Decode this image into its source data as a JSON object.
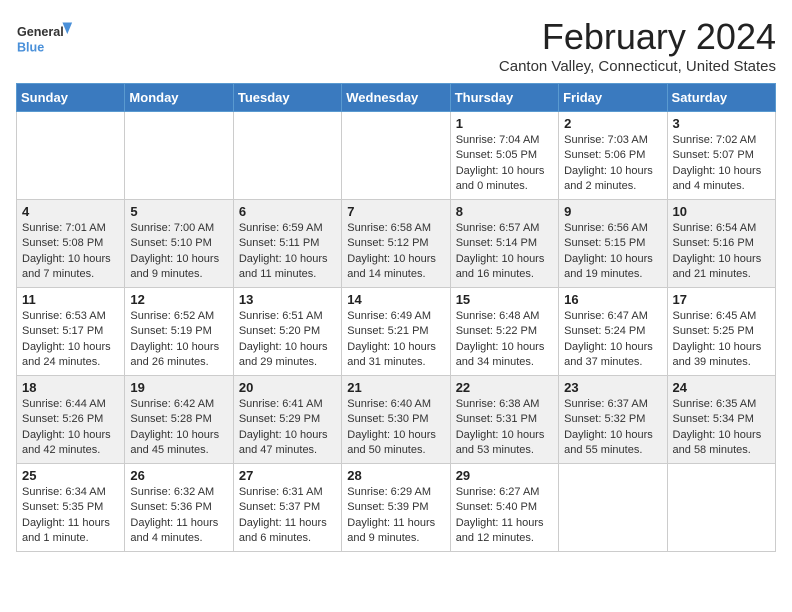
{
  "header": {
    "logo_line1": "General",
    "logo_line2": "Blue",
    "title": "February 2024",
    "subtitle": "Canton Valley, Connecticut, United States"
  },
  "days_of_week": [
    "Sunday",
    "Monday",
    "Tuesday",
    "Wednesday",
    "Thursday",
    "Friday",
    "Saturday"
  ],
  "weeks": [
    [
      {
        "day": "",
        "content": ""
      },
      {
        "day": "",
        "content": ""
      },
      {
        "day": "",
        "content": ""
      },
      {
        "day": "",
        "content": ""
      },
      {
        "day": "1",
        "content": "Sunrise: 7:04 AM\nSunset: 5:05 PM\nDaylight: 10 hours and 0 minutes."
      },
      {
        "day": "2",
        "content": "Sunrise: 7:03 AM\nSunset: 5:06 PM\nDaylight: 10 hours and 2 minutes."
      },
      {
        "day": "3",
        "content": "Sunrise: 7:02 AM\nSunset: 5:07 PM\nDaylight: 10 hours and 4 minutes."
      }
    ],
    [
      {
        "day": "4",
        "content": "Sunrise: 7:01 AM\nSunset: 5:08 PM\nDaylight: 10 hours and 7 minutes."
      },
      {
        "day": "5",
        "content": "Sunrise: 7:00 AM\nSunset: 5:10 PM\nDaylight: 10 hours and 9 minutes."
      },
      {
        "day": "6",
        "content": "Sunrise: 6:59 AM\nSunset: 5:11 PM\nDaylight: 10 hours and 11 minutes."
      },
      {
        "day": "7",
        "content": "Sunrise: 6:58 AM\nSunset: 5:12 PM\nDaylight: 10 hours and 14 minutes."
      },
      {
        "day": "8",
        "content": "Sunrise: 6:57 AM\nSunset: 5:14 PM\nDaylight: 10 hours and 16 minutes."
      },
      {
        "day": "9",
        "content": "Sunrise: 6:56 AM\nSunset: 5:15 PM\nDaylight: 10 hours and 19 minutes."
      },
      {
        "day": "10",
        "content": "Sunrise: 6:54 AM\nSunset: 5:16 PM\nDaylight: 10 hours and 21 minutes."
      }
    ],
    [
      {
        "day": "11",
        "content": "Sunrise: 6:53 AM\nSunset: 5:17 PM\nDaylight: 10 hours and 24 minutes."
      },
      {
        "day": "12",
        "content": "Sunrise: 6:52 AM\nSunset: 5:19 PM\nDaylight: 10 hours and 26 minutes."
      },
      {
        "day": "13",
        "content": "Sunrise: 6:51 AM\nSunset: 5:20 PM\nDaylight: 10 hours and 29 minutes."
      },
      {
        "day": "14",
        "content": "Sunrise: 6:49 AM\nSunset: 5:21 PM\nDaylight: 10 hours and 31 minutes."
      },
      {
        "day": "15",
        "content": "Sunrise: 6:48 AM\nSunset: 5:22 PM\nDaylight: 10 hours and 34 minutes."
      },
      {
        "day": "16",
        "content": "Sunrise: 6:47 AM\nSunset: 5:24 PM\nDaylight: 10 hours and 37 minutes."
      },
      {
        "day": "17",
        "content": "Sunrise: 6:45 AM\nSunset: 5:25 PM\nDaylight: 10 hours and 39 minutes."
      }
    ],
    [
      {
        "day": "18",
        "content": "Sunrise: 6:44 AM\nSunset: 5:26 PM\nDaylight: 10 hours and 42 minutes."
      },
      {
        "day": "19",
        "content": "Sunrise: 6:42 AM\nSunset: 5:28 PM\nDaylight: 10 hours and 45 minutes."
      },
      {
        "day": "20",
        "content": "Sunrise: 6:41 AM\nSunset: 5:29 PM\nDaylight: 10 hours and 47 minutes."
      },
      {
        "day": "21",
        "content": "Sunrise: 6:40 AM\nSunset: 5:30 PM\nDaylight: 10 hours and 50 minutes."
      },
      {
        "day": "22",
        "content": "Sunrise: 6:38 AM\nSunset: 5:31 PM\nDaylight: 10 hours and 53 minutes."
      },
      {
        "day": "23",
        "content": "Sunrise: 6:37 AM\nSunset: 5:32 PM\nDaylight: 10 hours and 55 minutes."
      },
      {
        "day": "24",
        "content": "Sunrise: 6:35 AM\nSunset: 5:34 PM\nDaylight: 10 hours and 58 minutes."
      }
    ],
    [
      {
        "day": "25",
        "content": "Sunrise: 6:34 AM\nSunset: 5:35 PM\nDaylight: 11 hours and 1 minute."
      },
      {
        "day": "26",
        "content": "Sunrise: 6:32 AM\nSunset: 5:36 PM\nDaylight: 11 hours and 4 minutes."
      },
      {
        "day": "27",
        "content": "Sunrise: 6:31 AM\nSunset: 5:37 PM\nDaylight: 11 hours and 6 minutes."
      },
      {
        "day": "28",
        "content": "Sunrise: 6:29 AM\nSunset: 5:39 PM\nDaylight: 11 hours and 9 minutes."
      },
      {
        "day": "29",
        "content": "Sunrise: 6:27 AM\nSunset: 5:40 PM\nDaylight: 11 hours and 12 minutes."
      },
      {
        "day": "",
        "content": ""
      },
      {
        "day": "",
        "content": ""
      }
    ]
  ]
}
